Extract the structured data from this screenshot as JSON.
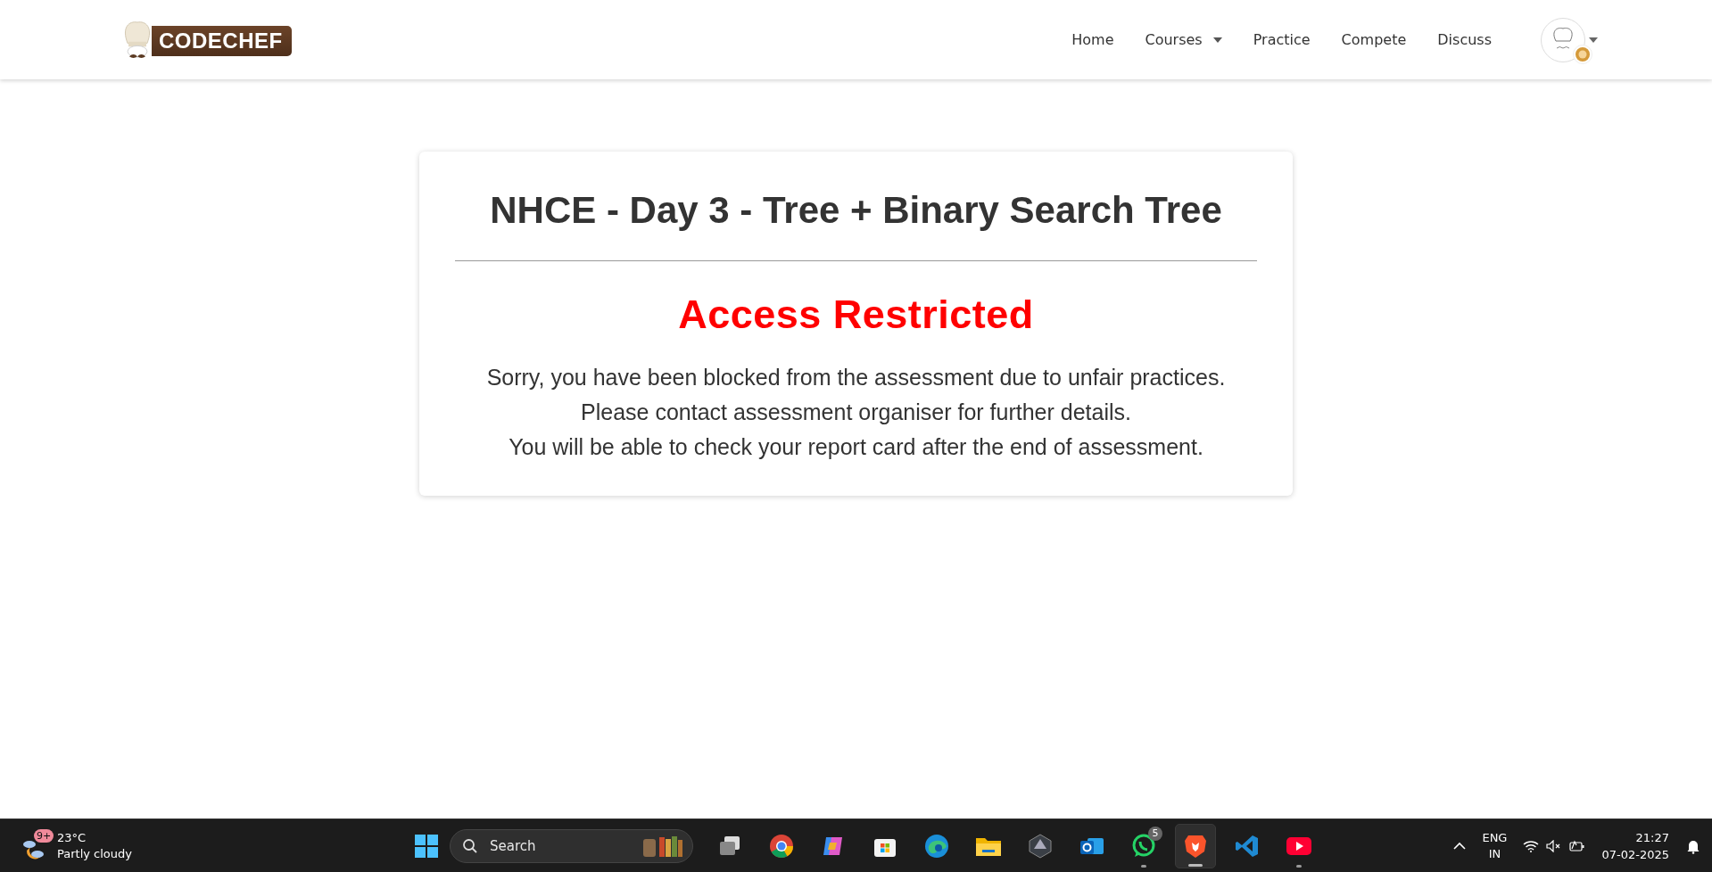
{
  "header": {
    "logo_text": "CODECHEF",
    "nav": [
      {
        "label": "Home",
        "dropdown": false
      },
      {
        "label": "Courses",
        "dropdown": true
      },
      {
        "label": "Practice",
        "dropdown": false
      },
      {
        "label": "Compete",
        "dropdown": false
      },
      {
        "label": "Discuss",
        "dropdown": false
      }
    ]
  },
  "card": {
    "title": "NHCE - Day 3 - Tree + Binary Search Tree",
    "heading": "Access Restricted",
    "lines": [
      "Sorry, you have been blocked from the assessment due to unfair practices.",
      "Please contact assessment organiser for further details.",
      "You will be able to check your report card after the end of assessment."
    ]
  },
  "taskbar": {
    "weather": {
      "badge": "9+",
      "temperature": "23°C",
      "condition": "Partly cloudy"
    },
    "search": {
      "placeholder": "Search"
    },
    "apps": [
      {
        "kind": "taskview",
        "running": false,
        "selected": false
      },
      {
        "kind": "chrome",
        "running": false,
        "selected": false
      },
      {
        "kind": "copilot",
        "running": false,
        "selected": false
      },
      {
        "kind": "store",
        "running": false,
        "selected": false
      },
      {
        "kind": "edge",
        "running": false,
        "selected": false
      },
      {
        "kind": "files",
        "running": false,
        "selected": false
      },
      {
        "kind": "cube",
        "running": false,
        "selected": false
      },
      {
        "kind": "outlook",
        "running": false,
        "selected": false
      },
      {
        "kind": "whatsapp",
        "running": true,
        "selected": false,
        "badge": "5"
      },
      {
        "kind": "brave",
        "running": true,
        "selected": true
      },
      {
        "kind": "vscode",
        "running": false,
        "selected": false
      },
      {
        "kind": "youtube",
        "running": true,
        "selected": false
      }
    ],
    "language": [
      "ENG",
      "IN"
    ],
    "time": "21:27",
    "date": "07-02-2025"
  }
}
